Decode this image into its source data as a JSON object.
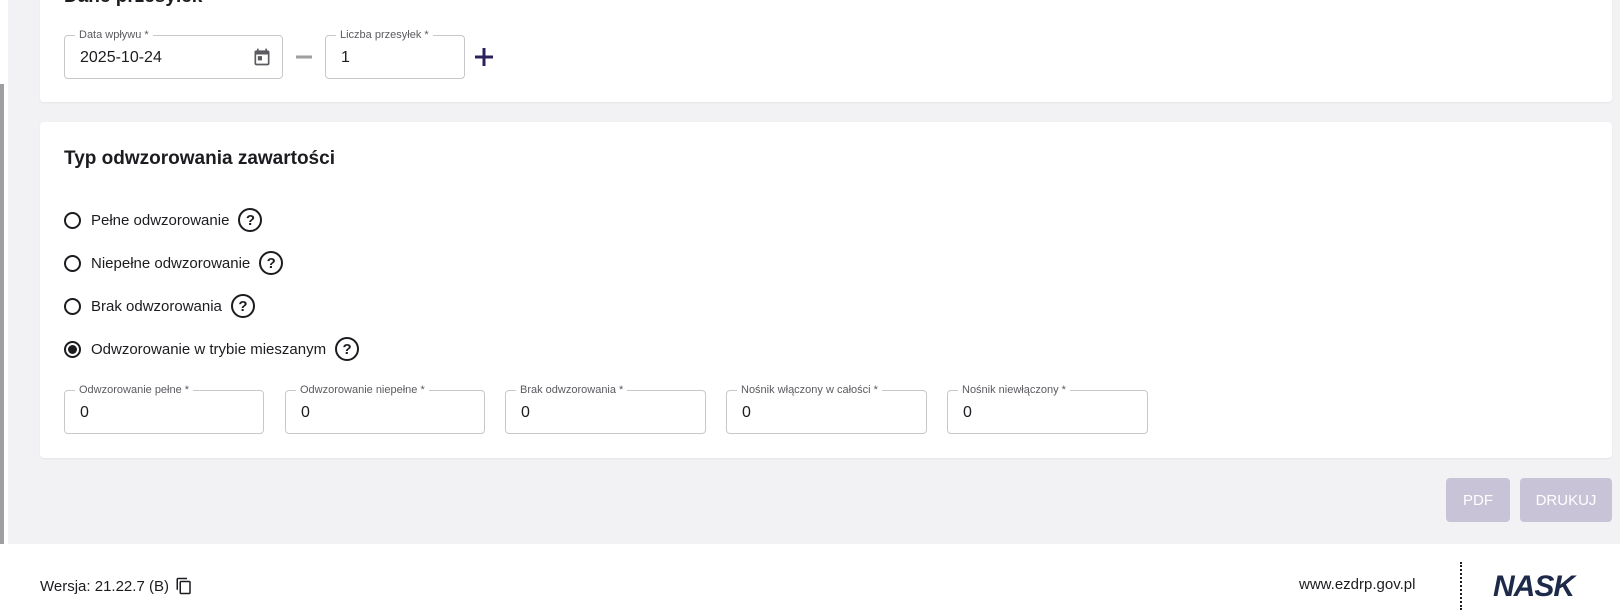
{
  "top_section": {
    "title": "Dane przesyłek",
    "date_field": {
      "label": "Data wpływu *",
      "value": "2025-10-24"
    },
    "count_field": {
      "label": "Liczba przesyłek *",
      "value": "1"
    },
    "decrement_icon": "minus-icon",
    "increment_icon": "plus-icon"
  },
  "mapping_section": {
    "title": "Typ odwzorowania zawartości",
    "options": [
      {
        "label": "Pełne odwzorowanie",
        "selected": false
      },
      {
        "label": "Niepełne odwzorowanie",
        "selected": false
      },
      {
        "label": "Brak odwzorowania",
        "selected": false
      },
      {
        "label": "Odwzorowanie w trybie mieszanym",
        "selected": true
      }
    ],
    "help_glyph": "?",
    "fields": [
      {
        "label": "Odwzorowanie pełne *",
        "value": "0"
      },
      {
        "label": "Odwzorowanie niepełne *",
        "value": "0"
      },
      {
        "label": "Brak odwzorowania *",
        "value": "0"
      },
      {
        "label": "Nośnik włączony w całości *",
        "value": "0"
      },
      {
        "label": "Nośnik niewłączony *",
        "value": "0"
      }
    ]
  },
  "actions": {
    "pdf_label": "PDF",
    "print_label": "DRUKUJ"
  },
  "footer": {
    "version": "Wersja: 21.22.7 (B)",
    "site": "www.ezdrp.gov.pl",
    "logo_text": "NASK"
  },
  "colors": {
    "accent": "#2c1f5e",
    "disabled_button": "#c8c3d6",
    "page_bg": "#f2f2f4"
  }
}
